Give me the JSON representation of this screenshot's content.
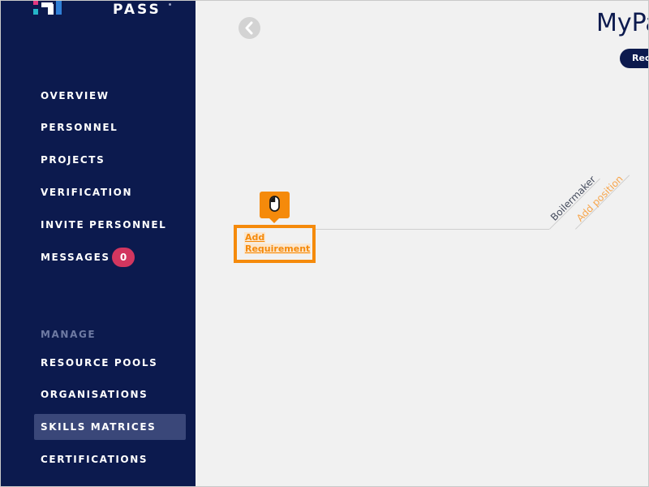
{
  "brand": {
    "name": "PASS"
  },
  "sidebar": {
    "items": [
      {
        "label": "OVERVIEW"
      },
      {
        "label": "PERSONNEL"
      },
      {
        "label": "PROJECTS"
      },
      {
        "label": "VERIFICATION"
      },
      {
        "label": "INVITE PERSONNEL"
      },
      {
        "label": "MESSAGES",
        "badge": "0"
      }
    ],
    "manage_heading": "MANAGE",
    "manage_items": [
      {
        "label": "RESOURCE POOLS"
      },
      {
        "label": "ORGANISATIONS"
      },
      {
        "label": "SKILLS MATRICES",
        "active": true
      },
      {
        "label": "CERTIFICATIONS"
      }
    ]
  },
  "main": {
    "title": "MyPa",
    "pill_label": "Rec",
    "matrix": {
      "positions": [
        "Boilermaker"
      ],
      "add_position_label": "Add position",
      "add_requirement_label_line1": "Add",
      "add_requirement_label_line2": "Requirement"
    },
    "tooltip_icon": "mouse-icon"
  },
  "colors": {
    "sidebar_bg": "#0c1a4e",
    "accent_orange": "#f58a0b",
    "badge_red": "#d2365f",
    "active_item_bg": "#3a4779",
    "page_bg": "#f1f1f1"
  }
}
